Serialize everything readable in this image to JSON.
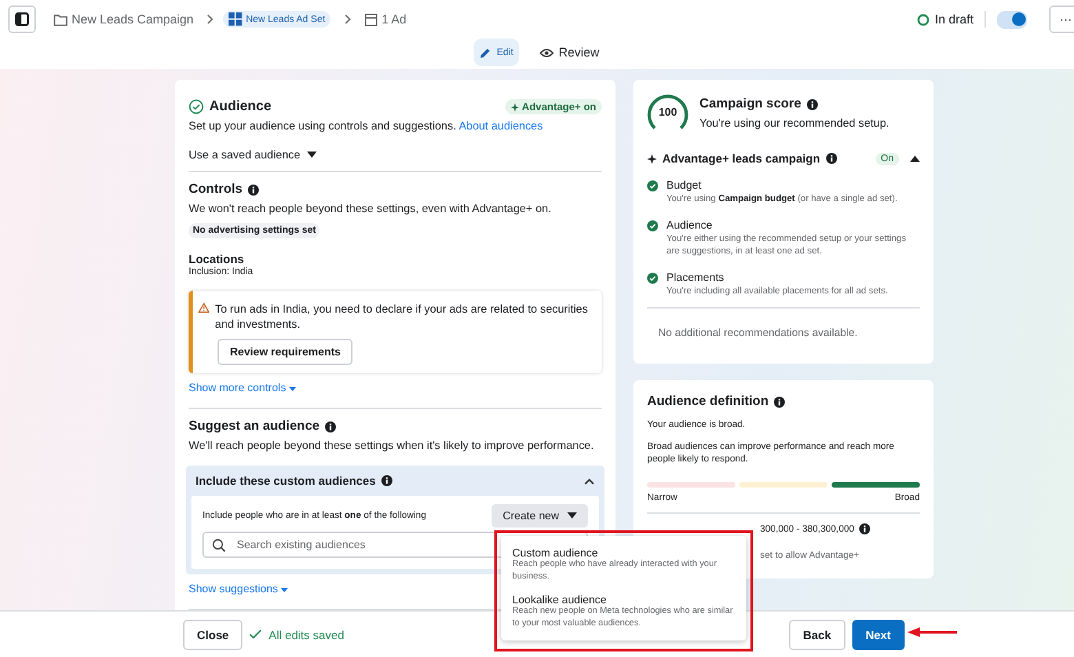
{
  "breadcrumbs": [
    {
      "kind": "folder",
      "label": "New Leads Campaign",
      "selected": false
    },
    {
      "kind": "adset",
      "label": "New Leads Ad Set",
      "selected": true
    },
    {
      "kind": "ad",
      "label": "1 Ad",
      "selected": false
    }
  ],
  "status": {
    "label": "In draft",
    "on": true,
    "more": "···"
  },
  "mode_tabs": [
    {
      "kind": "edit",
      "label": "Edit",
      "selected": true
    },
    {
      "kind": "review",
      "label": "Review",
      "selected": false
    }
  ],
  "audience": {
    "title": "Audience",
    "badge": "Advantage+ on",
    "intro": "Set up your audience using controls and suggestions.",
    "intro_link": "About audiences",
    "saved_audience": "Use a saved audience",
    "controls": {
      "title": "Controls",
      "text": "We won't reach people beyond these settings, even with Advantage+ on.",
      "chip": "No advertising settings set",
      "locations_title": "Locations",
      "locations_value": "Inclusion: India"
    },
    "warning": {
      "text": "To run ads in India, you need to declare if your ads are related to securities and investments.",
      "button": "Review requirements"
    },
    "show_more": "Show more controls",
    "suggest": {
      "title": "Suggest an audience",
      "text": "We'll reach people beyond these settings when it's likely to improve performance."
    },
    "custom": {
      "title": "Include these custom audiences",
      "expanded": true,
      "rule": "Include people who are in at least **one** of the following",
      "create_button": "Create new",
      "search_placeholder": "Search existing audiences"
    },
    "show_suggestions": "Show suggestions"
  },
  "create_menu": [
    {
      "title": "Custom audience",
      "description": "Reach people who have already interacted with your business."
    },
    {
      "title": "Lookalike audience",
      "description": "Reach new people on Meta technologies who are similar to your most valuable audiences."
    }
  ],
  "campaign_score": {
    "score": "100",
    "title": "Campaign score",
    "subtitle": "You're using our recommended setup.",
    "section_title": "Advantage+ leads campaign",
    "section_badge": "On",
    "expanded": true,
    "items": [
      {
        "title": "Budget",
        "text": "You're using **Campaign budget** (or have a single ad set)."
      },
      {
        "title": "Audience",
        "text": "You're either using the recommended setup or your settings are suggestions, in at least one ad set."
      },
      {
        "title": "Placements",
        "text": "You're including all available placements for all ad sets."
      }
    ],
    "footer": "No additional recommendations available."
  },
  "audience_definition": {
    "title": "Audience definition",
    "status": "Your audience is broad.",
    "text": "Broad audiences can improve performance and reach more people likely to respond.",
    "segments": [
      {
        "color": "#fbe3e4"
      },
      {
        "color": "#fcf1d2"
      },
      {
        "color": "#1f7a4d"
      }
    ],
    "low_label": "Narrow",
    "high_label": "Broad",
    "size": "300,000 - 380,300,000",
    "note": "set to allow Advantage+"
  },
  "footer": {
    "close": "Close",
    "saved": "All edits saved",
    "back": "Back",
    "next": "Next"
  }
}
